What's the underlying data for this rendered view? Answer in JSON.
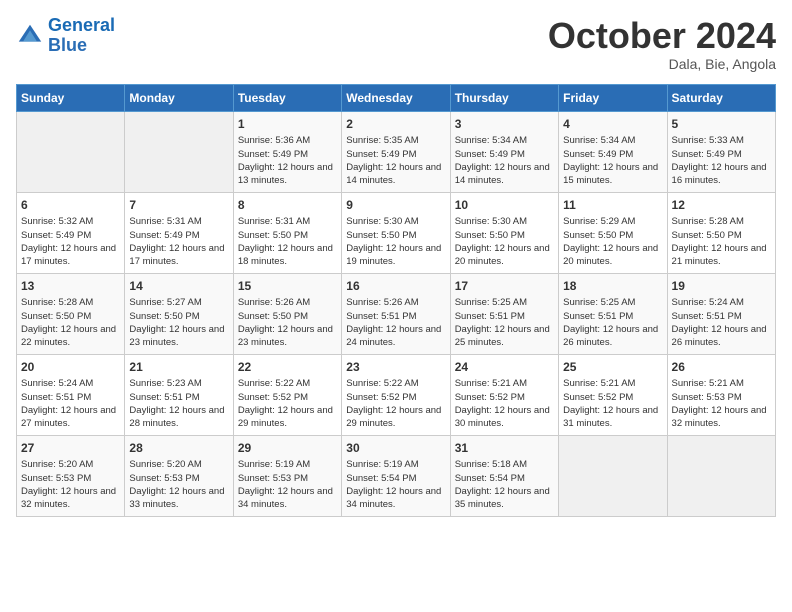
{
  "header": {
    "logo_line1": "General",
    "logo_line2": "Blue",
    "month": "October 2024",
    "location": "Dala, Bie, Angola"
  },
  "weekdays": [
    "Sunday",
    "Monday",
    "Tuesday",
    "Wednesday",
    "Thursday",
    "Friday",
    "Saturday"
  ],
  "weeks": [
    [
      {
        "day": "",
        "info": ""
      },
      {
        "day": "",
        "info": ""
      },
      {
        "day": "1",
        "sunrise": "Sunrise: 5:36 AM",
        "sunset": "Sunset: 5:49 PM",
        "daylight": "Daylight: 12 hours and 13 minutes."
      },
      {
        "day": "2",
        "sunrise": "Sunrise: 5:35 AM",
        "sunset": "Sunset: 5:49 PM",
        "daylight": "Daylight: 12 hours and 14 minutes."
      },
      {
        "day": "3",
        "sunrise": "Sunrise: 5:34 AM",
        "sunset": "Sunset: 5:49 PM",
        "daylight": "Daylight: 12 hours and 14 minutes."
      },
      {
        "day": "4",
        "sunrise": "Sunrise: 5:34 AM",
        "sunset": "Sunset: 5:49 PM",
        "daylight": "Daylight: 12 hours and 15 minutes."
      },
      {
        "day": "5",
        "sunrise": "Sunrise: 5:33 AM",
        "sunset": "Sunset: 5:49 PM",
        "daylight": "Daylight: 12 hours and 16 minutes."
      }
    ],
    [
      {
        "day": "6",
        "sunrise": "Sunrise: 5:32 AM",
        "sunset": "Sunset: 5:49 PM",
        "daylight": "Daylight: 12 hours and 17 minutes."
      },
      {
        "day": "7",
        "sunrise": "Sunrise: 5:31 AM",
        "sunset": "Sunset: 5:49 PM",
        "daylight": "Daylight: 12 hours and 17 minutes."
      },
      {
        "day": "8",
        "sunrise": "Sunrise: 5:31 AM",
        "sunset": "Sunset: 5:50 PM",
        "daylight": "Daylight: 12 hours and 18 minutes."
      },
      {
        "day": "9",
        "sunrise": "Sunrise: 5:30 AM",
        "sunset": "Sunset: 5:50 PM",
        "daylight": "Daylight: 12 hours and 19 minutes."
      },
      {
        "day": "10",
        "sunrise": "Sunrise: 5:30 AM",
        "sunset": "Sunset: 5:50 PM",
        "daylight": "Daylight: 12 hours and 20 minutes."
      },
      {
        "day": "11",
        "sunrise": "Sunrise: 5:29 AM",
        "sunset": "Sunset: 5:50 PM",
        "daylight": "Daylight: 12 hours and 20 minutes."
      },
      {
        "day": "12",
        "sunrise": "Sunrise: 5:28 AM",
        "sunset": "Sunset: 5:50 PM",
        "daylight": "Daylight: 12 hours and 21 minutes."
      }
    ],
    [
      {
        "day": "13",
        "sunrise": "Sunrise: 5:28 AM",
        "sunset": "Sunset: 5:50 PM",
        "daylight": "Daylight: 12 hours and 22 minutes."
      },
      {
        "day": "14",
        "sunrise": "Sunrise: 5:27 AM",
        "sunset": "Sunset: 5:50 PM",
        "daylight": "Daylight: 12 hours and 23 minutes."
      },
      {
        "day": "15",
        "sunrise": "Sunrise: 5:26 AM",
        "sunset": "Sunset: 5:50 PM",
        "daylight": "Daylight: 12 hours and 23 minutes."
      },
      {
        "day": "16",
        "sunrise": "Sunrise: 5:26 AM",
        "sunset": "Sunset: 5:51 PM",
        "daylight": "Daylight: 12 hours and 24 minutes."
      },
      {
        "day": "17",
        "sunrise": "Sunrise: 5:25 AM",
        "sunset": "Sunset: 5:51 PM",
        "daylight": "Daylight: 12 hours and 25 minutes."
      },
      {
        "day": "18",
        "sunrise": "Sunrise: 5:25 AM",
        "sunset": "Sunset: 5:51 PM",
        "daylight": "Daylight: 12 hours and 26 minutes."
      },
      {
        "day": "19",
        "sunrise": "Sunrise: 5:24 AM",
        "sunset": "Sunset: 5:51 PM",
        "daylight": "Daylight: 12 hours and 26 minutes."
      }
    ],
    [
      {
        "day": "20",
        "sunrise": "Sunrise: 5:24 AM",
        "sunset": "Sunset: 5:51 PM",
        "daylight": "Daylight: 12 hours and 27 minutes."
      },
      {
        "day": "21",
        "sunrise": "Sunrise: 5:23 AM",
        "sunset": "Sunset: 5:51 PM",
        "daylight": "Daylight: 12 hours and 28 minutes."
      },
      {
        "day": "22",
        "sunrise": "Sunrise: 5:22 AM",
        "sunset": "Sunset: 5:52 PM",
        "daylight": "Daylight: 12 hours and 29 minutes."
      },
      {
        "day": "23",
        "sunrise": "Sunrise: 5:22 AM",
        "sunset": "Sunset: 5:52 PM",
        "daylight": "Daylight: 12 hours and 29 minutes."
      },
      {
        "day": "24",
        "sunrise": "Sunrise: 5:21 AM",
        "sunset": "Sunset: 5:52 PM",
        "daylight": "Daylight: 12 hours and 30 minutes."
      },
      {
        "day": "25",
        "sunrise": "Sunrise: 5:21 AM",
        "sunset": "Sunset: 5:52 PM",
        "daylight": "Daylight: 12 hours and 31 minutes."
      },
      {
        "day": "26",
        "sunrise": "Sunrise: 5:21 AM",
        "sunset": "Sunset: 5:53 PM",
        "daylight": "Daylight: 12 hours and 32 minutes."
      }
    ],
    [
      {
        "day": "27",
        "sunrise": "Sunrise: 5:20 AM",
        "sunset": "Sunset: 5:53 PM",
        "daylight": "Daylight: 12 hours and 32 minutes."
      },
      {
        "day": "28",
        "sunrise": "Sunrise: 5:20 AM",
        "sunset": "Sunset: 5:53 PM",
        "daylight": "Daylight: 12 hours and 33 minutes."
      },
      {
        "day": "29",
        "sunrise": "Sunrise: 5:19 AM",
        "sunset": "Sunset: 5:53 PM",
        "daylight": "Daylight: 12 hours and 34 minutes."
      },
      {
        "day": "30",
        "sunrise": "Sunrise: 5:19 AM",
        "sunset": "Sunset: 5:54 PM",
        "daylight": "Daylight: 12 hours and 34 minutes."
      },
      {
        "day": "31",
        "sunrise": "Sunrise: 5:18 AM",
        "sunset": "Sunset: 5:54 PM",
        "daylight": "Daylight: 12 hours and 35 minutes."
      },
      {
        "day": "",
        "info": ""
      },
      {
        "day": "",
        "info": ""
      }
    ]
  ]
}
